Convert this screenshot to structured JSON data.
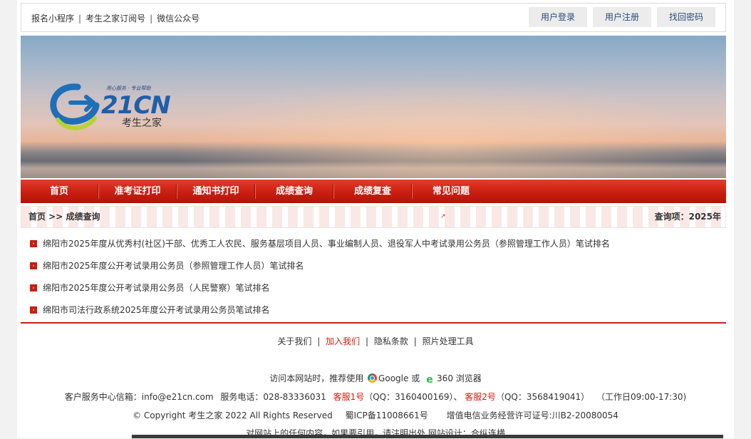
{
  "topbar": {
    "links": [
      "报名小程序",
      "考生之家订阅号",
      "微信公众号"
    ],
    "separator": "|",
    "buttons": {
      "login": "用户登录",
      "register": "用户注册",
      "recover": "找回密码"
    }
  },
  "logo": {
    "slogan": "用心服务 · 专业帮助",
    "name": "21CN",
    "subtitle": "考生之家"
  },
  "nav": [
    "首页",
    "准考证打印",
    "通知书打印",
    "成绩查询",
    "成绩复查",
    "常见问题"
  ],
  "breadcrumb": {
    "path": "首页 >> 成绩查询",
    "query_label": "查询项：",
    "query_value": "2025年"
  },
  "list": [
    "绵阳市2025年度从优秀村(社区)干部、优秀工人农民、服务基层项目人员、事业编制人员、退役军人中考试录用公务员（参照管理工作人员）笔试排名",
    "绵阳市2025年度公开考试录用公务员（参照管理工作人员）笔试排名",
    "绵阳市2025年度公开考试录用公务员（人民警察）笔试排名",
    "绵阳市司法行政系统2025年度公开考试录用公务员笔试排名"
  ],
  "footer": {
    "links": [
      "关于我们",
      "加入我们",
      "隐私条款",
      "照片处理工具"
    ],
    "separator": "|",
    "browser_prefix": "访问本网站时，推荐使用",
    "browser_google": "Google",
    "browser_or": "或",
    "browser_360": "360 浏览器",
    "contact_email": "客户服务中心信箱：info@e21cn.com",
    "contact_phone": "服务电话：028-83336031",
    "kefu1": "客服1号",
    "kefu1_qq": "（QQ：3160400169）、",
    "kefu2": "客服2号",
    "kefu2_qq": "（QQ：3568419041）",
    "hours": "（工作日09:00-17:30)",
    "copyright": "© Copyright 考生之家 2022 All Rights Reserved",
    "icp": "蜀ICP备11008661号",
    "license": "增值电信业务经营许可证号:川B2-20080054",
    "notice": "对网站上的任何内容，如果要引用，请注明出处   网站设计：合纵连横"
  },
  "colors": {
    "brand_red": "#c91e10",
    "link_blue": "#2a4c7a"
  }
}
